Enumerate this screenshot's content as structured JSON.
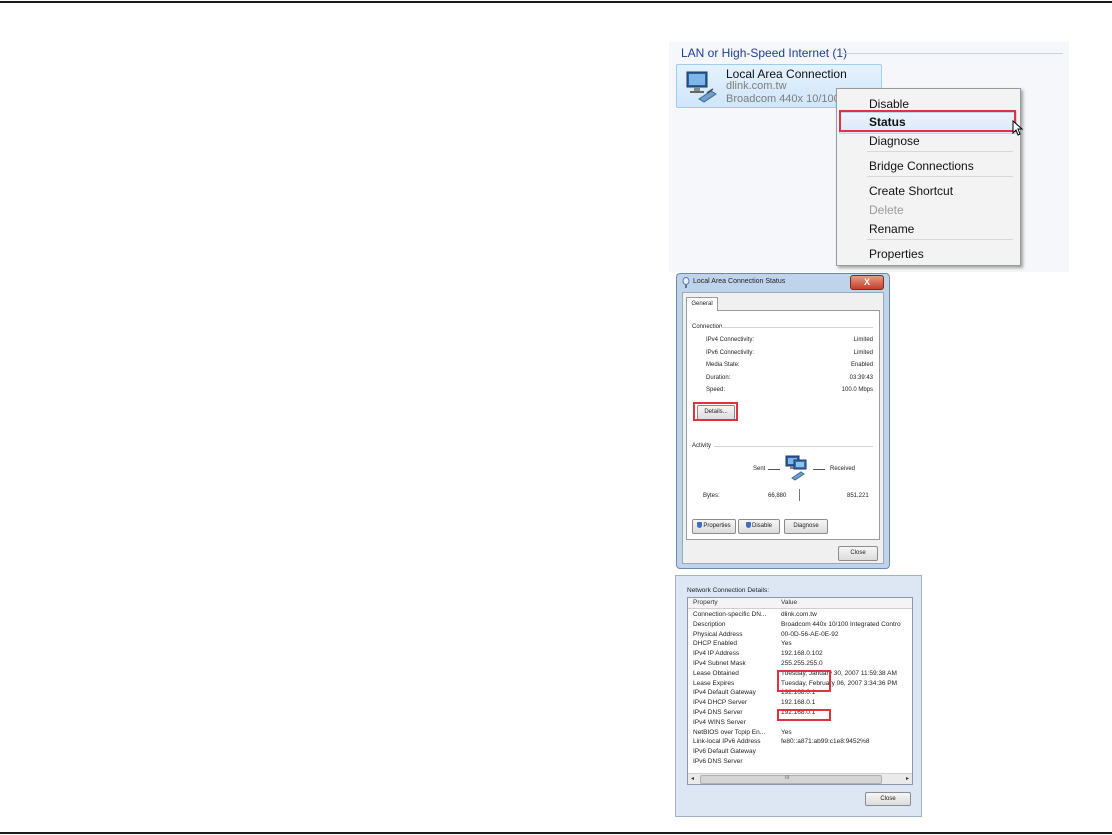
{
  "network_folder": {
    "group_header": "LAN or High-Speed Internet (1)",
    "connection": {
      "name": "Local Area Connection",
      "domain": "dlink.com.tw",
      "adapter": "Broadcom 440x 10/100"
    },
    "context_menu": {
      "items": [
        {
          "label": "Disable",
          "state": "normal"
        },
        {
          "label": "Status",
          "state": "highlighted"
        },
        {
          "label": "Diagnose",
          "state": "normal"
        },
        {
          "label": "Bridge Connections",
          "state": "normal"
        },
        {
          "label": "Create Shortcut",
          "state": "normal"
        },
        {
          "label": "Delete",
          "state": "disabled"
        },
        {
          "label": "Rename",
          "state": "normal"
        },
        {
          "label": "Properties",
          "state": "normal"
        }
      ]
    }
  },
  "status_dialog": {
    "title": "Local Area Connection Status",
    "close_label": "X",
    "tab": "General",
    "connection_label": "Connection",
    "rows": [
      {
        "label": "IPv4 Connectivity:",
        "value": "Limited"
      },
      {
        "label": "IPv6 Connectivity:",
        "value": "Limited"
      },
      {
        "label": "Media State:",
        "value": "Enabled"
      },
      {
        "label": "Duration:",
        "value": "03:39:43"
      },
      {
        "label": "Speed:",
        "value": "100.0 Mbps"
      }
    ],
    "details_button": "Details...",
    "activity_label": "Activity",
    "sent_label": "Sent",
    "received_label": "Received",
    "bytes_label": "Bytes:",
    "bytes_sent": "66,880",
    "bytes_received": "851,221",
    "properties_button": "Properties",
    "disable_button": "Disable",
    "diagnose_button": "Diagnose",
    "close_button": "Close"
  },
  "details_dialog": {
    "heading": "Network Connection Details:",
    "col_property": "Property",
    "col_value": "Value",
    "rows": [
      {
        "p": "Connection-specific DN...",
        "v": "dlink.com.tw"
      },
      {
        "p": "Description",
        "v": "Broadcom 440x 10/100 Integrated Contro"
      },
      {
        "p": "Physical Address",
        "v": "00-0D-56-AE-0E-92"
      },
      {
        "p": "DHCP Enabled",
        "v": "Yes"
      },
      {
        "p": "IPv4 IP Address",
        "v": "192.168.0.102"
      },
      {
        "p": "IPv4 Subnet Mask",
        "v": "255.255.255.0"
      },
      {
        "p": "Lease Obtained",
        "v": "Tuesday, January 30, 2007 11:59:38 AM"
      },
      {
        "p": "Lease Expires",
        "v": "Tuesday, February 06, 2007 3:34:36 PM"
      },
      {
        "p": "IPv4 Default Gateway",
        "v": "192.168.0.1"
      },
      {
        "p": "IPv4 DHCP Server",
        "v": "192.168.0.1"
      },
      {
        "p": "IPv4 DNS Server",
        "v": "192.168.0.1"
      },
      {
        "p": "IPv4 WINS Server",
        "v": ""
      },
      {
        "p": "NetBIOS over Tcpip En...",
        "v": "Yes"
      },
      {
        "p": "Link-local IPv6 Address",
        "v": "fe80::a871:ab99:c1e8:9452%8"
      },
      {
        "p": "IPv6 Default Gateway",
        "v": ""
      },
      {
        "p": "IPv6 DNS Server",
        "v": ""
      }
    ],
    "scroll_mid": "III",
    "close_button": "Close"
  }
}
